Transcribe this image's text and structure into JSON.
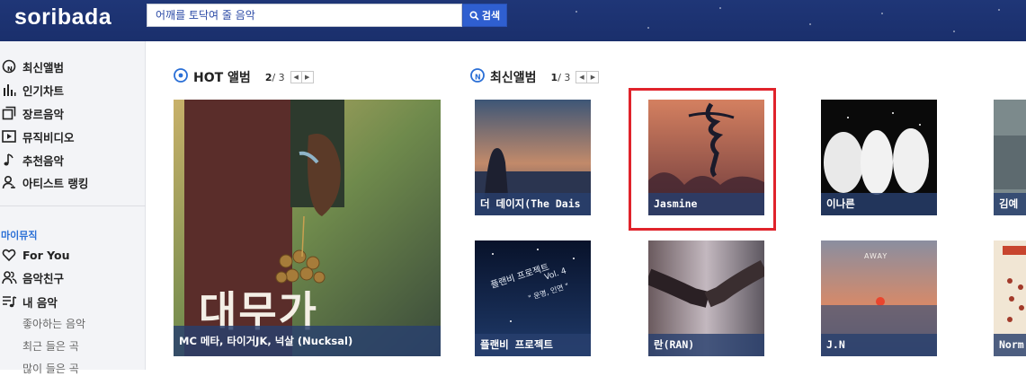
{
  "header": {
    "logo": "soribada",
    "search_placeholder": "어깨를 토닥여 줄 음악",
    "search_button": "검색"
  },
  "sidebar": {
    "items": [
      {
        "label": "최신앨범",
        "icon": "new-album-icon"
      },
      {
        "label": "인기차트",
        "icon": "chart-bars-icon"
      },
      {
        "label": "장르음악",
        "icon": "genre-squares-icon"
      },
      {
        "label": "뮤직비디오",
        "icon": "play-video-icon"
      },
      {
        "label": "추천음악",
        "icon": "music-note-icon"
      },
      {
        "label": "아티스트 랭킹",
        "icon": "artist-ranking-icon"
      }
    ],
    "my_music_label": "마이뮤직",
    "my_items": [
      {
        "label": "For You",
        "icon": "heart-icon"
      },
      {
        "label": "음악친구",
        "icon": "friends-icon"
      },
      {
        "label": "내 음악",
        "icon": "playlist-icon"
      }
    ],
    "sub_items": [
      "좋아하는 음악",
      "최근 들은 곡",
      "많이 들은 곡"
    ]
  },
  "hot_section": {
    "title": "HOT 앨범",
    "page_current": "2",
    "page_total": "/ 3",
    "album": {
      "caption": "MC 메타, 타이거JK, 넉살 (Nucksal)",
      "cover_text": "대무가"
    }
  },
  "new_section": {
    "title": "최신앨범",
    "page_current": "1",
    "page_total": "/ 3",
    "albums": [
      {
        "caption": "더 데이지(The Dais"
      },
      {
        "caption": "Jasmine"
      },
      {
        "caption": "이나른"
      },
      {
        "caption": "김예"
      },
      {
        "caption": "플랜비 프로젝트"
      },
      {
        "caption": "란(RAN)"
      },
      {
        "caption": "J.N"
      },
      {
        "caption": "Norm"
      }
    ]
  },
  "cover_texts": {
    "away": "AWAY",
    "planb_line1": "플랜비 프로젝트",
    "planb_line2": "Vol. 4",
    "planb_line3": "\" 운명, 인연 \""
  },
  "colors": {
    "header_bg": "#1d3272",
    "accent_blue": "#2a6fd6",
    "highlight_red": "#e0232b",
    "caption_bg": "#28406e"
  }
}
